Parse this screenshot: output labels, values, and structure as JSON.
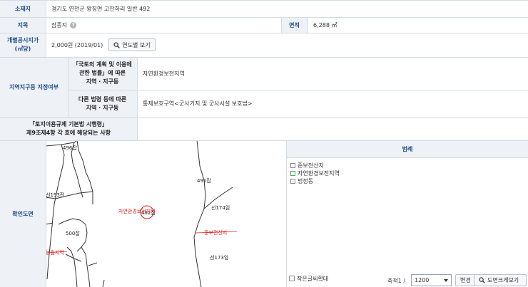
{
  "location": {
    "label": "소재지",
    "value": "경기도 연천군 왕징면 고잔하리 일반 492"
  },
  "land_category": {
    "label": "지목",
    "value": "잡종지",
    "help_icon": "question-circle-icon"
  },
  "area": {
    "label": "면적",
    "value": "6,288 ㎡"
  },
  "official_price": {
    "label_line1": "개별공시지가",
    "label_line2": "(㎡당)",
    "value": "2,000원 (2019/01)",
    "button_label": "연도별 보기",
    "button_icon": "search-icon"
  },
  "zoning": {
    "label": "지역지구등 지정여부",
    "row1_label_line1": "「국토의 계획 및 이용에",
    "row1_label_line2": "관한 법률」에 따른",
    "row1_label_line3": "지역 · 지구등",
    "row1_value": "자연환경보전지역",
    "row2_label_line1": "다른 법령 등에 따른",
    "row2_label_line2": "지역 · 지구등",
    "row2_value": "통제보호구역<군사기지 및 군사시설 보호법>"
  },
  "regulation": {
    "label_line1": "「토지이용규제 기본법 시행령」",
    "label_line2": "제9조제4항 각 호에 해당되는 사항",
    "value": ""
  },
  "map": {
    "label": "확인도면",
    "parcel_labels": [
      "496잡",
      "491잡",
      "선193전",
      "500잡",
      "선174임",
      "선173임"
    ],
    "zone_labels": [
      "자연환경보전지역",
      "준보전산지",
      "농림지역"
    ],
    "center_parcel": "492잡"
  },
  "legend": {
    "title": "범례",
    "items": [
      "준보전산지",
      "자연환경보전지역",
      "법정동"
    ],
    "item_colors": [
      "#888888",
      "#4caf50",
      "#888888"
    ]
  },
  "controls": {
    "small_text_label": "작은글씨확대",
    "scale_label": "축적1 /",
    "scale_value": "1200",
    "change_button": "변경",
    "enlarge_button": "도면크게보기",
    "enlarge_icon": "magnifier-icon"
  },
  "colors": {
    "header_bg": "#eef2f7",
    "header_text": "#1f4d8c",
    "border": "#d5dbe3",
    "zone_red": "#e02020"
  }
}
